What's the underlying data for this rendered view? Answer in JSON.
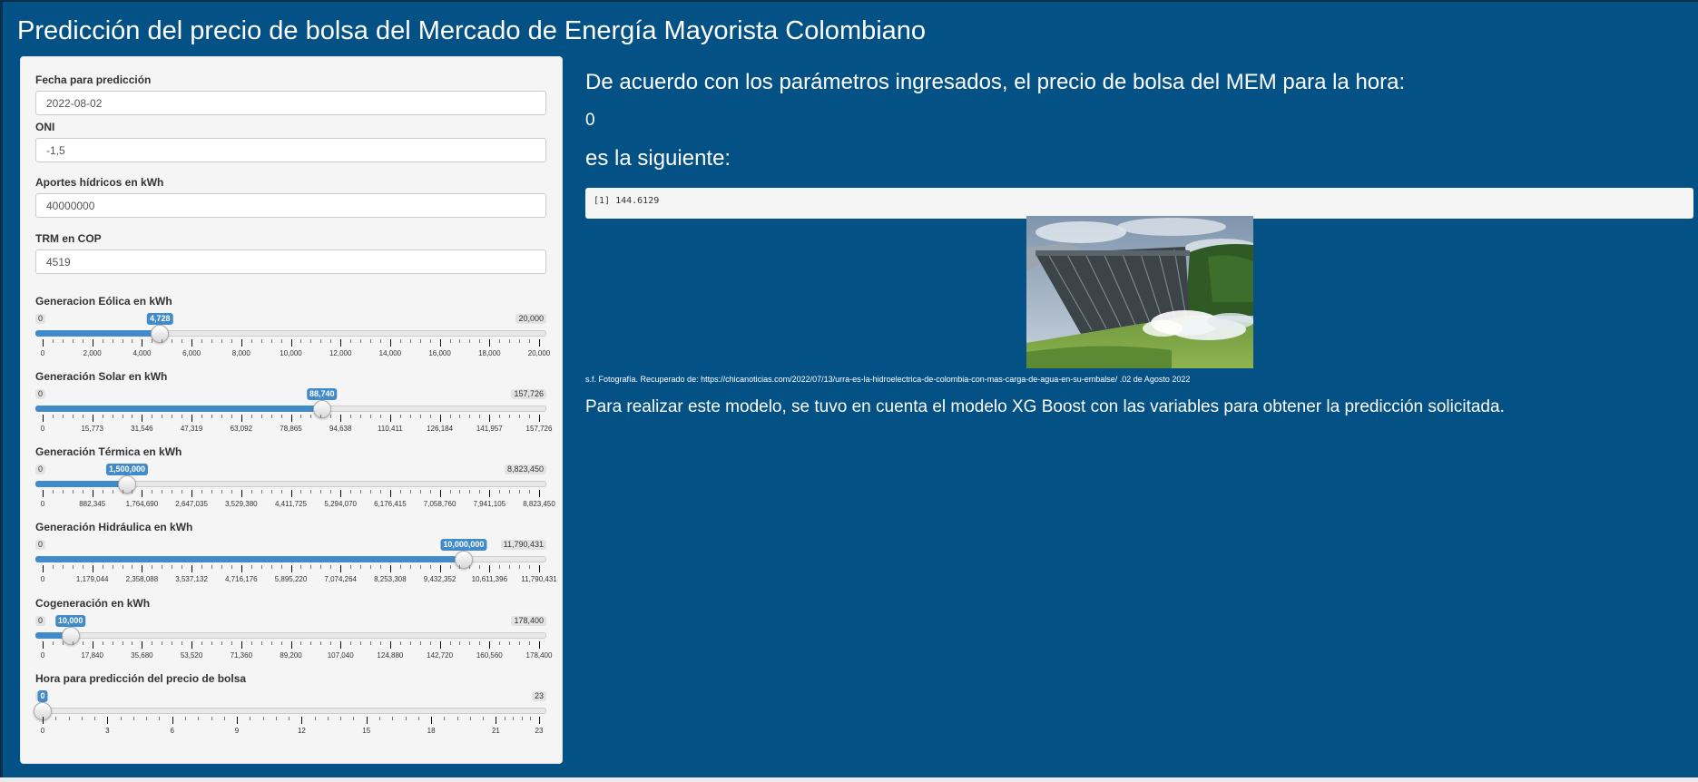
{
  "app_title": "Predicción del precio de bolsa del Mercado de Energía Mayorista Colombiano",
  "colors": {
    "background": "#045186",
    "accent": "#428bca",
    "panel": "#f5f5f5"
  },
  "sidebar": {
    "date": {
      "label": "Fecha para predicción",
      "value": "2022-08-02"
    },
    "oni": {
      "label": "ONI",
      "value": "-1,5"
    },
    "hydro_inflows": {
      "label": "Aportes hídricos en kWh",
      "value": "40000000"
    },
    "trm": {
      "label": "TRM en COP",
      "value": "4519"
    },
    "sliders": [
      {
        "label": "Generacion Eólica en kWh",
        "min": 0,
        "max": 20000,
        "value": 4728,
        "min_label": "0",
        "max_label": "20,000",
        "value_label": "4,728",
        "ticks": [
          "0",
          "2,000",
          "4,000",
          "6,000",
          "8,000",
          "10,000",
          "12,000",
          "14,000",
          "16,000",
          "18,000",
          "20,000"
        ]
      },
      {
        "label": "Generación Solar en kWh",
        "min": 0,
        "max": 157726,
        "value": 88740,
        "min_label": "0",
        "max_label": "157,726",
        "value_label": "88,740",
        "ticks": [
          "0",
          "15,773",
          "31,546",
          "47,319",
          "63,092",
          "78,865",
          "94,638",
          "110,411",
          "126,184",
          "141,957",
          "157,726"
        ]
      },
      {
        "label": "Generación Térmica en kWh",
        "min": 0,
        "max": 8823450,
        "value": 1500000,
        "min_label": "0",
        "max_label": "8,823,450",
        "value_label": "1,500,000",
        "ticks": [
          "0",
          "882,345",
          "1,764,690",
          "2,647,035",
          "3,529,380",
          "4,411,725",
          "5,294,070",
          "6,176,415",
          "7,058,760",
          "7,941,105",
          "8,823,450"
        ]
      },
      {
        "label": "Generación Hidráulica en kWh",
        "min": 0,
        "max": 11790431,
        "value": 10000000,
        "min_label": "0",
        "max_label": "11,790,431",
        "value_label": "10,000,000",
        "ticks": [
          "0",
          "1,179,044",
          "2,358,088",
          "3,537,132",
          "4,716,176",
          "5,895,220",
          "7,074,264",
          "8,253,308",
          "9,432,352",
          "10,611,396",
          "11,790,431"
        ]
      },
      {
        "label": "Cogeneración en kWh",
        "min": 0,
        "max": 178400,
        "value": 10000,
        "min_label": "0",
        "max_label": "178,400",
        "value_label": "10,000",
        "ticks": [
          "0",
          "17,840",
          "35,680",
          "53,520",
          "71,360",
          "89,200",
          "107,040",
          "124,880",
          "142,720",
          "160,560",
          "178,400"
        ]
      },
      {
        "label": "Hora para predicción del precio de bolsa",
        "min": 0,
        "max": 23,
        "value": 0,
        "min_label": "0",
        "max_label": "23",
        "value_label": "0",
        "ticks": [
          "0",
          "3",
          "6",
          "9",
          "12",
          "15",
          "18",
          "21",
          "23"
        ],
        "tick_values": [
          0,
          3,
          6,
          9,
          12,
          15,
          18,
          21,
          23
        ]
      }
    ]
  },
  "main": {
    "heading_1": "De acuerdo con los parámetros ingresados, el precio de bolsa del MEM para la hora:",
    "hour": "0",
    "heading_2": "es la siguiente:",
    "result": "[1] 144.6129",
    "caption": "s.f. Fotografía. Recuperado de: https://chicanoticias.com/2022/07/13/urra-es-la-hidroelectrica-de-colombia-con-mas-carga-de-agua-en-su-embalse/ .02 de Agosto 2022",
    "description": "Para realizar este modelo, se tuvo en cuenta el modelo XG Boost con las variables para obtener la predicción solicitada."
  }
}
